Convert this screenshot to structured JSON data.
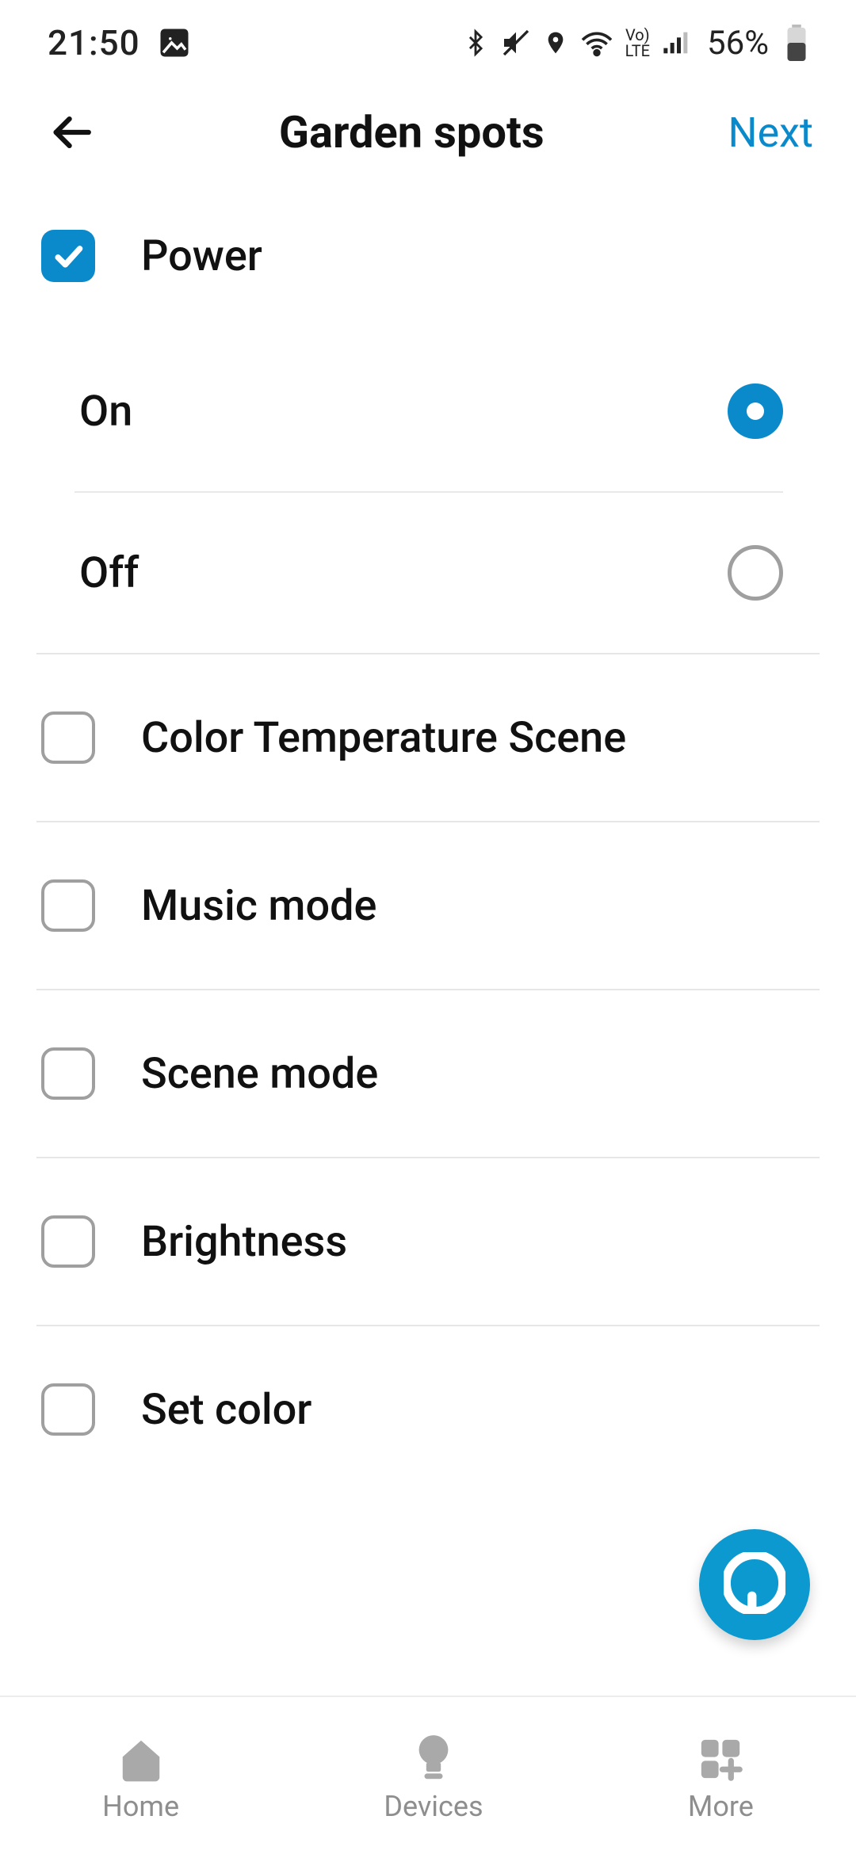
{
  "status": {
    "time": "21:50",
    "battery": "56%"
  },
  "header": {
    "title": "Garden spots",
    "next": "Next"
  },
  "power": {
    "label": "Power",
    "checked": true,
    "options": {
      "on_label": "On",
      "off_label": "Off",
      "selected": "on"
    }
  },
  "capabilities": [
    {
      "label": "Color Temperature Scene",
      "checked": false
    },
    {
      "label": "Music mode",
      "checked": false
    },
    {
      "label": "Scene mode",
      "checked": false
    },
    {
      "label": "Brightness",
      "checked": false
    },
    {
      "label": "Set color",
      "checked": false
    }
  ],
  "nav": {
    "home": "Home",
    "devices": "Devices",
    "more": "More"
  },
  "colors": {
    "accent": "#0b8acb",
    "fab": "#0b99cf",
    "muted": "#8e8e8e",
    "divider": "#e6e6e6"
  }
}
